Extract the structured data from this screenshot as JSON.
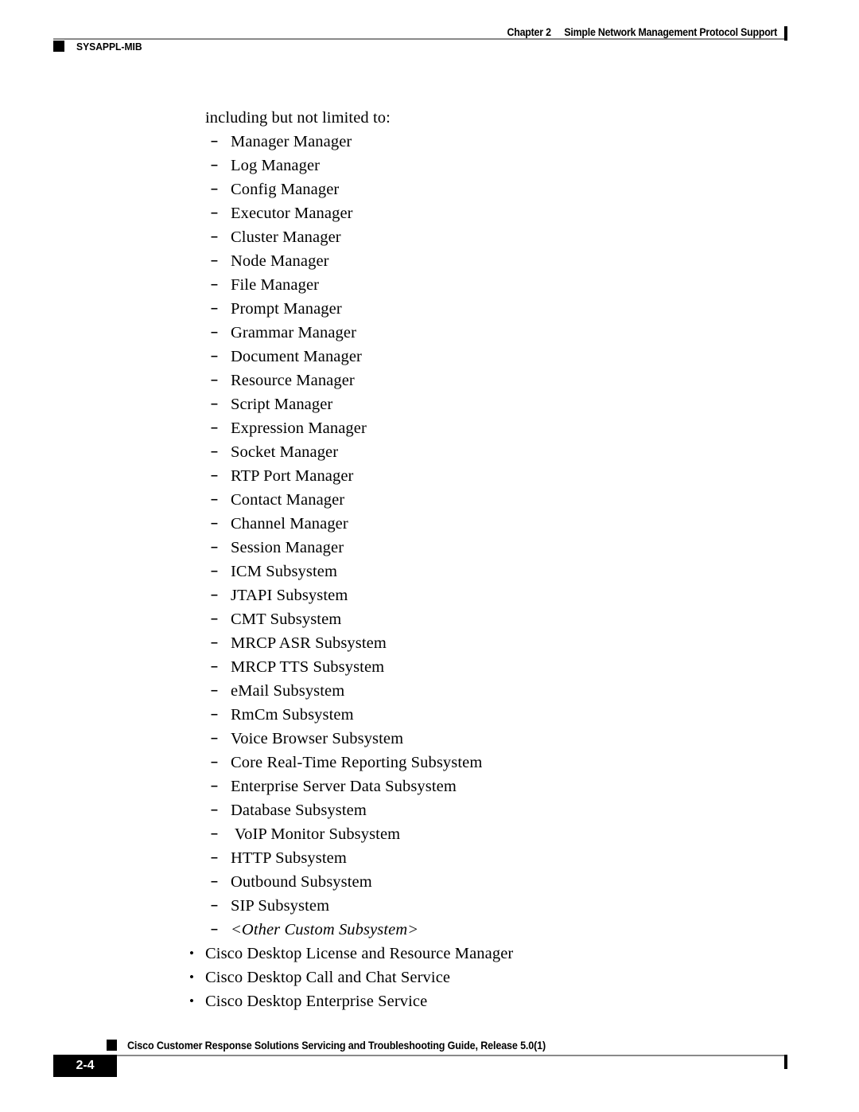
{
  "header": {
    "chapter_label": "Chapter 2",
    "chapter_title": "Simple Network Management Protocol Support",
    "section_label": "SYSAPPL-MIB"
  },
  "body": {
    "lead_paragraph": "including but not limited to:",
    "dash_marker": "–",
    "bullet_marker": "•",
    "dash_items": [
      {
        "text": "Manager Manager",
        "italic": false
      },
      {
        "text": "Log Manager",
        "italic": false
      },
      {
        "text": "Config Manager",
        "italic": false
      },
      {
        "text": "Executor Manager",
        "italic": false
      },
      {
        "text": "Cluster Manager",
        "italic": false
      },
      {
        "text": "Node Manager",
        "italic": false
      },
      {
        "text": "File Manager",
        "italic": false
      },
      {
        "text": "Prompt Manager",
        "italic": false
      },
      {
        "text": "Grammar Manager",
        "italic": false
      },
      {
        "text": "Document Manager",
        "italic": false
      },
      {
        "text": "Resource Manager",
        "italic": false
      },
      {
        "text": "Script Manager",
        "italic": false
      },
      {
        "text": "Expression Manager",
        "italic": false
      },
      {
        "text": "Socket Manager",
        "italic": false
      },
      {
        "text": "RTP Port Manager",
        "italic": false
      },
      {
        "text": "Contact Manager",
        "italic": false
      },
      {
        "text": "Channel Manager",
        "italic": false
      },
      {
        "text": "Session Manager",
        "italic": false
      },
      {
        "text": "ICM Subsystem",
        "italic": false
      },
      {
        "text": "JTAPI Subsystem",
        "italic": false
      },
      {
        "text": "CMT Subsystem",
        "italic": false
      },
      {
        "text": "MRCP ASR Subsystem",
        "italic": false
      },
      {
        "text": "MRCP TTS Subsystem",
        "italic": false
      },
      {
        "text": "eMail Subsystem",
        "italic": false
      },
      {
        "text": "RmCm Subsystem",
        "italic": false
      },
      {
        "text": "Voice Browser Subsystem",
        "italic": false
      },
      {
        "text": "Core Real-Time Reporting Subsystem",
        "italic": false
      },
      {
        "text": "Enterprise Server Data Subsystem",
        "italic": false
      },
      {
        "text": "Database Subsystem",
        "italic": false
      },
      {
        "text": " VoIP Monitor Subsystem",
        "italic": false
      },
      {
        "text": "HTTP Subsystem",
        "italic": false
      },
      {
        "text": "Outbound Subsystem",
        "italic": false
      },
      {
        "text": "SIP Subsystem",
        "italic": false
      },
      {
        "text": "<Other Custom Subsystem>",
        "italic": true
      }
    ],
    "bullet_items": [
      "Cisco Desktop License and Resource Manager",
      "Cisco Desktop Call and Chat Service",
      "Cisco Desktop Enterprise Service"
    ]
  },
  "footer": {
    "document_title": "Cisco Customer Response Solutions Servicing and Troubleshooting Guide, Release 5.0(1)",
    "page_number": "2-4"
  }
}
